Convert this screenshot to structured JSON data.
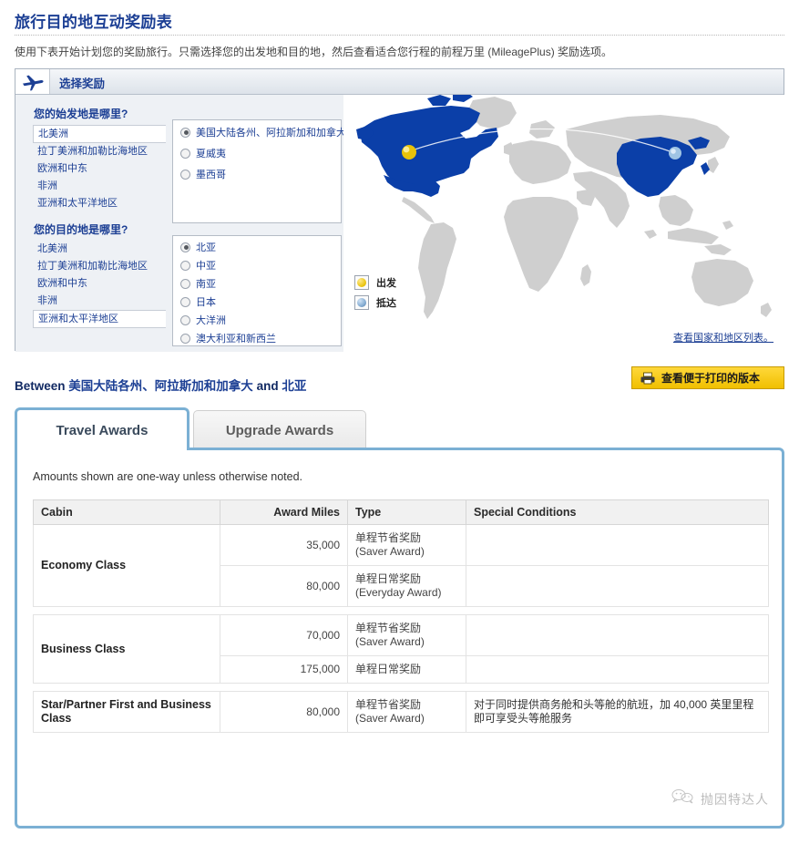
{
  "header": {
    "title": "旅行目的地互动奖励表",
    "intro": "使用下表开始计划您的奖励旅行。只需选择您的出发地和目的地，然后查看适合您行程的前程万里 (MileagePlus) 奖励选项。"
  },
  "selector": {
    "panel_heading": "选择奖励",
    "plane_icon": "airplane-icon",
    "origin": {
      "question": "您的始发地是哪里?",
      "regions": [
        "北美洲",
        "拉丁美洲和加勒比海地区",
        "欧洲和中东",
        "非洲",
        "亚洲和太平洋地区"
      ],
      "selected_region": "北美洲",
      "options": [
        "美国大陆各州、阿拉斯加和加拿大",
        "夏威夷",
        "墨西哥"
      ],
      "selected_option": "美国大陆各州、阿拉斯加和加拿大"
    },
    "destination": {
      "question": "您的目的地是哪里?",
      "regions": [
        "北美洲",
        "拉丁美洲和加勒比海地区",
        "欧洲和中东",
        "非洲",
        "亚洲和太平洋地区"
      ],
      "selected_region": "亚洲和太平洋地区",
      "options": [
        "北亚",
        "中亚",
        "南亚",
        "日本",
        "大洋洲",
        "澳大利亚和新西兰"
      ],
      "selected_option": "北亚"
    }
  },
  "map": {
    "legend": [
      {
        "icon": "depart-marker-icon",
        "label": "出发",
        "color": "#e8c20a"
      },
      {
        "icon": "arrive-marker-icon",
        "label": "抵达",
        "color": "#7fa8cf"
      }
    ],
    "link_text": "查看国家和地区列表。",
    "highlight_color": "#0b3fa8",
    "base_color": "#cfcfcf"
  },
  "route": {
    "prefix": "Between",
    "origin": "美国大陆各州、阿拉斯加和加拿大",
    "connector": "and",
    "destination": "北亚"
  },
  "print_button": {
    "label": "查看便于打印的版本",
    "icon": "printer-icon",
    "color": "#f0bf00"
  },
  "tabs": [
    {
      "label": "Travel Awards",
      "active": true
    },
    {
      "label": "Upgrade Awards",
      "active": false
    }
  ],
  "results": {
    "note": "Amounts shown are one-way unless otherwise noted.",
    "columns": [
      "Cabin",
      "Award Miles",
      "Type",
      "Special Conditions"
    ],
    "groups": [
      {
        "cabin": "Economy Class",
        "rows": [
          {
            "miles": "35,000",
            "type": "单程节省奖励\n(Saver Award)",
            "conditions": ""
          },
          {
            "miles": "80,000",
            "type": "单程日常奖励\n(Everyday Award)",
            "conditions": ""
          }
        ]
      },
      {
        "cabin": "Business Class",
        "rows": [
          {
            "miles": "70,000",
            "type": "单程节省奖励\n(Saver Award)",
            "conditions": ""
          },
          {
            "miles": "175,000",
            "type": "单程日常奖励",
            "conditions": ""
          }
        ]
      },
      {
        "cabin": "Star/Partner First and Business Class",
        "rows": [
          {
            "miles": "80,000",
            "type": "单程节省奖励\n(Saver Award)",
            "conditions": "对于同时提供商务舱和头等舱的航班，加 40,000 英里里程即可享受头等舱服务"
          }
        ]
      }
    ]
  },
  "watermark": {
    "text": "抛因特达人",
    "icon": "wechat-icon"
  }
}
